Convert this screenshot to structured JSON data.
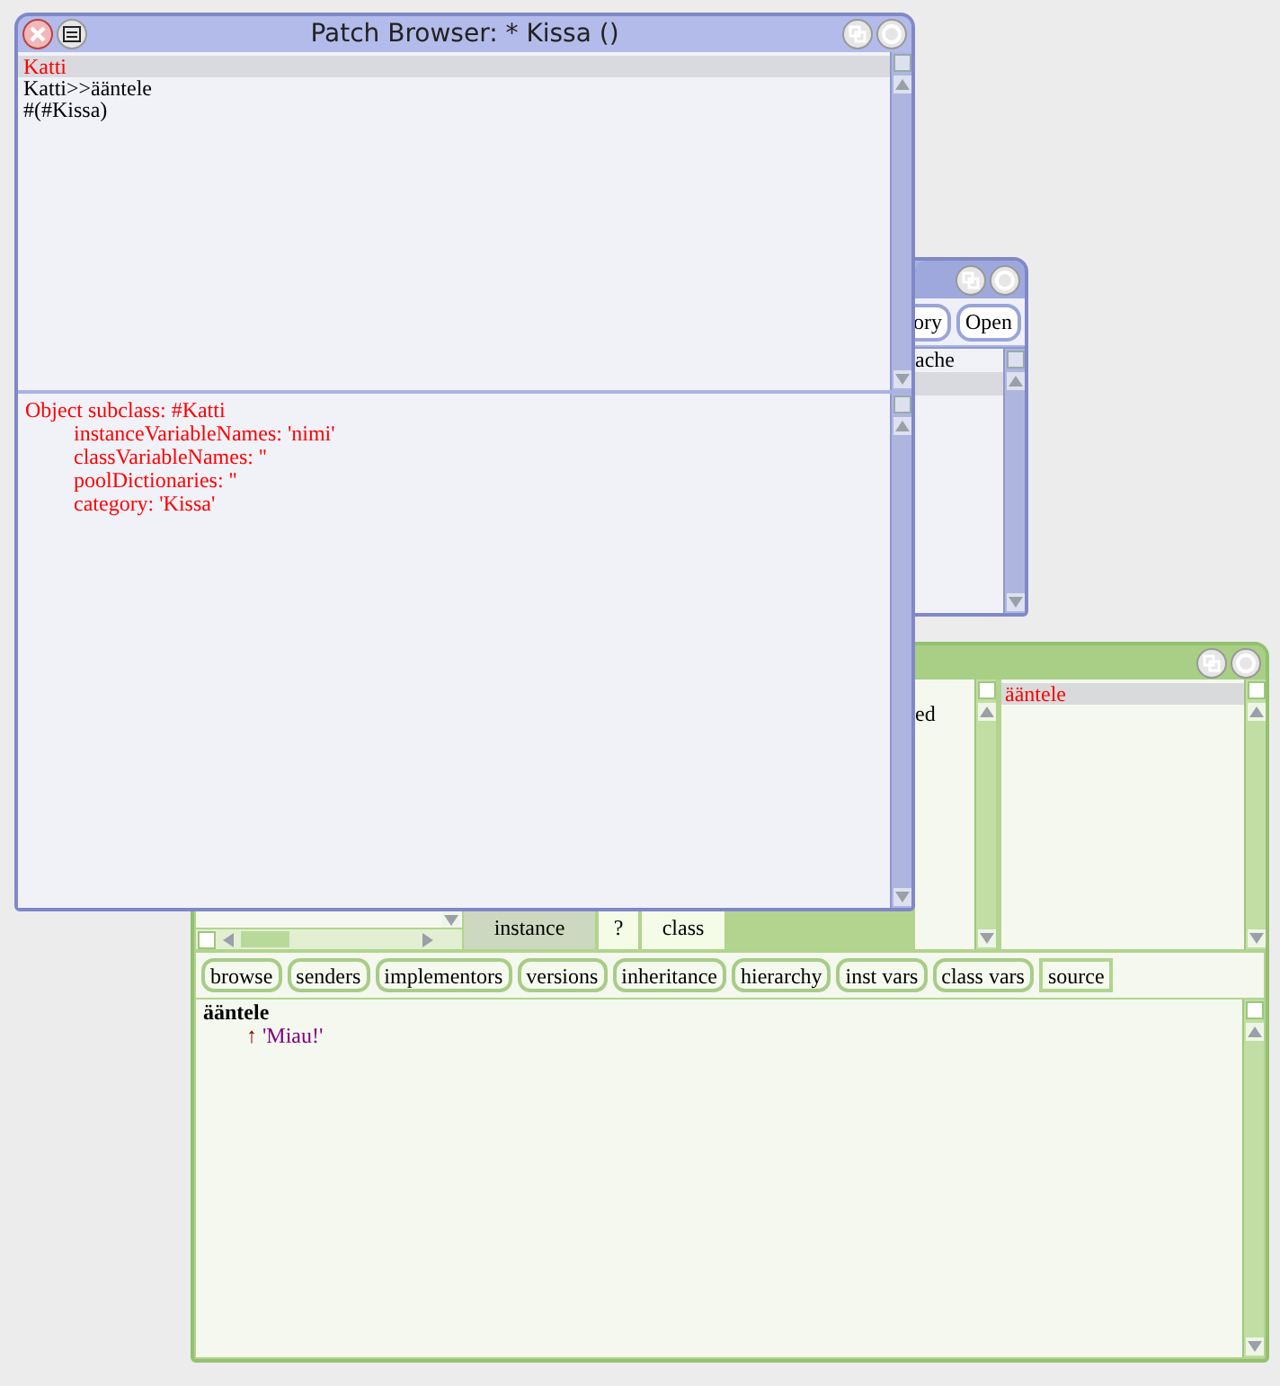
{
  "file_list_window": {
    "buttons": [
      "ory",
      "Open"
    ],
    "list": [
      {
        "text": "ache",
        "selected": false
      },
      {
        "selected": true
      }
    ]
  },
  "browser_window": {
    "protocols": [
      {
        "text": "ed",
        "selected": false
      }
    ],
    "class_switches": [
      {
        "label": "instance",
        "selected": true
      },
      {
        "label": "?",
        "selected": false
      },
      {
        "label": "class",
        "selected": false
      }
    ],
    "methods": [
      {
        "text": "ääntele",
        "selected": true
      }
    ],
    "buttons": [
      {
        "label": "browse",
        "kind": "button"
      },
      {
        "label": "senders",
        "kind": "button"
      },
      {
        "label": "implementors",
        "kind": "button"
      },
      {
        "label": "versions",
        "kind": "button"
      },
      {
        "label": "inheritance",
        "kind": "button"
      },
      {
        "label": "hierarchy",
        "kind": "button"
      },
      {
        "label": "inst vars",
        "kind": "button"
      },
      {
        "label": "class vars",
        "kind": "button"
      },
      {
        "label": "source",
        "kind": "menu"
      }
    ],
    "code": [
      {
        "indented": false,
        "parts": [
          {
            "text": "ääntele",
            "kind": "selector"
          }
        ]
      },
      {
        "indented": true,
        "parts": [
          {
            "text": "↑",
            "kind": "return"
          },
          {
            "text": "'Miau!'",
            "kind": "string"
          }
        ]
      }
    ]
  },
  "patch_browser": {
    "title": "Patch Browser: * Kissa ()",
    "changes": [
      {
        "text": "Katti",
        "selected": true,
        "color": "#ff0000"
      },
      {
        "text": "Katti>>ääntele",
        "selected": false,
        "color": "#000000"
      },
      {
        "text": "#(#Kissa)",
        "selected": false,
        "color": "#000000"
      }
    ],
    "code": "Object subclass: #Katti\n\tinstanceVariableNames: 'nimi'\n\tclassVariableNames: ''\n\tpoolDictionaries: ''\n\tcategory: 'Kissa'"
  }
}
